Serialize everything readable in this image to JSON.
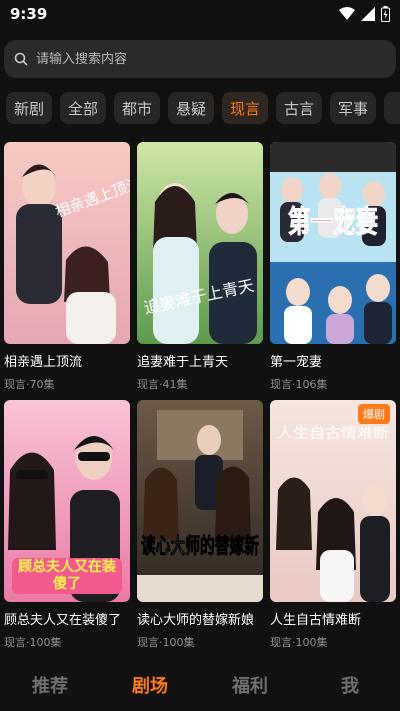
{
  "status": {
    "time": "9:39"
  },
  "search": {
    "placeholder": "请输入搜索内容"
  },
  "categories": [
    "新剧",
    "全部",
    "都市",
    "悬疑",
    "现言",
    "古言",
    "军事",
    "玄"
  ],
  "active_category": "现言",
  "cards": [
    {
      "title": "相亲遇上顶流",
      "meta": "现言·70集",
      "poster_text": "相亲遇上顶流"
    },
    {
      "title": "追妻难于上青天",
      "meta": "现言·41集",
      "poster_text": "追妻难于上青天"
    },
    {
      "title": "第一宠妻",
      "meta": "现言·106集",
      "poster_text": "第一宠妻"
    },
    {
      "title": "顾总夫人又在装傻了",
      "meta": "现言·100集",
      "poster_text": "顾总夫人又在装傻了"
    },
    {
      "title": "读心大师的替嫁新娘",
      "meta": "现言·100集",
      "poster_text": "读心大师的替嫁新"
    },
    {
      "title": "人生自古情难断",
      "meta": "现言·100集",
      "poster_text": "人生自古情难断",
      "badge": "爆剧"
    }
  ],
  "bottom_nav": [
    "推荐",
    "剧场",
    "福利",
    "我"
  ],
  "active_tab": "剧场",
  "colors": {
    "accent": "#ff7a1a",
    "background": "#111111"
  }
}
